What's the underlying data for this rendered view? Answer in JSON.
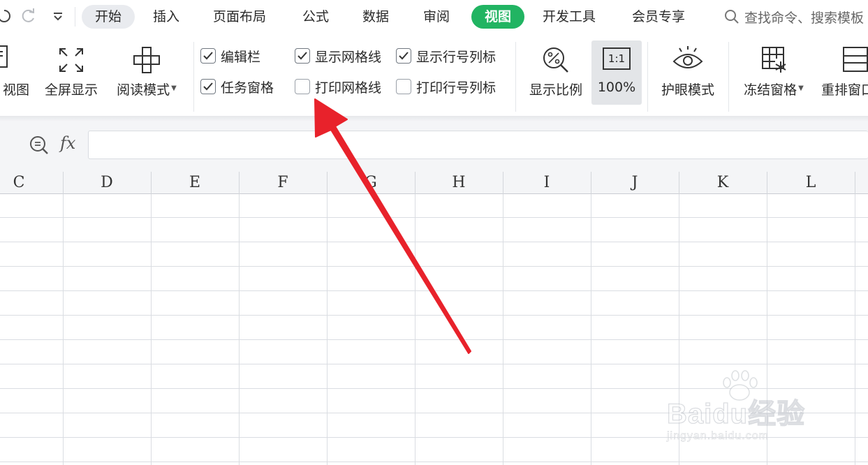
{
  "menu": {
    "tabs": [
      "开始",
      "插入",
      "页面布局",
      "公式",
      "数据",
      "审阅",
      "视图",
      "开发工具",
      "会员专享"
    ],
    "active_tab": "视图",
    "search_placeholder": "查找命令、搜索模板"
  },
  "ribbon": {
    "big_buttons": {
      "normal_view": "视图",
      "fullscreen": "全屏显示",
      "reading_mode": "阅读模式",
      "zoom_ratio": "显示比例",
      "zoom_100": "100%",
      "zoom_100_icon_text": "1:1",
      "eye_protection": "护眼模式",
      "freeze_panes": "冻结窗格",
      "rearrange_windows": "重排窗口"
    },
    "checkboxes": [
      {
        "label": "编辑栏",
        "checked": true
      },
      {
        "label": "任务窗格",
        "checked": true
      },
      {
        "label": "显示网格线",
        "checked": true
      },
      {
        "label": "打印网格线",
        "checked": false
      },
      {
        "label": "显示行号列标",
        "checked": true
      },
      {
        "label": "打印行号列标",
        "checked": false
      }
    ]
  },
  "formula_bar": {
    "fx_label": "fx",
    "value": ""
  },
  "sheet": {
    "columns": [
      "C",
      "D",
      "E",
      "F",
      "G",
      "H",
      "I",
      "J",
      "K",
      "L"
    ]
  },
  "annotation": {
    "arrow_color": "#e8222b"
  },
  "watermark": {
    "brand": "Baidu经验",
    "url": "jingyan.baidu.com"
  },
  "colors": {
    "accent_green": "#21b462",
    "grid_line": "#dadde2"
  }
}
